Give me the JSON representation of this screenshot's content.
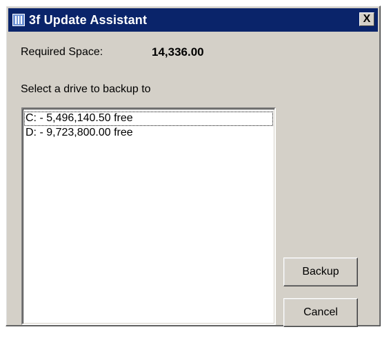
{
  "window": {
    "title": "3f Update Assistant",
    "close_label": "X"
  },
  "info": {
    "required_label": "Required Space:",
    "required_value": "14,336.00",
    "select_label": "Select a drive to backup to"
  },
  "drives": [
    {
      "label": "C: - 5,496,140.50 free"
    },
    {
      "label": "D: - 9,723,800.00 free"
    }
  ],
  "buttons": {
    "backup_label": "Backup",
    "cancel_label": "Cancel"
  },
  "icons": {
    "app": "app-icon",
    "close": "close-icon"
  },
  "colors": {
    "titlebar": "#0a246a",
    "dialog_bg": "#d4d0c8"
  }
}
